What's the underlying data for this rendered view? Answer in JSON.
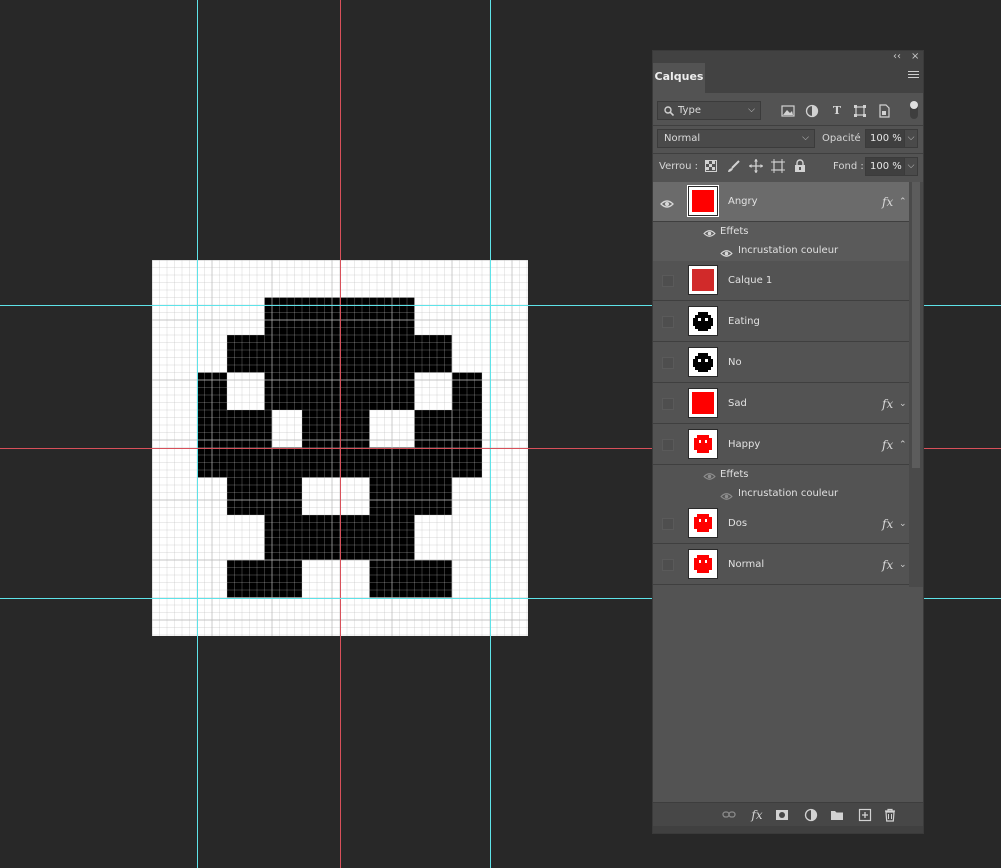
{
  "panel": {
    "collapse_label": "‹‹",
    "close_label": "×",
    "tab_label": "Calques",
    "filter": {
      "kind_label": "Type",
      "kind_icon": "search-icon"
    },
    "blend": {
      "mode": "Normal",
      "opacity_label": "Opacité :",
      "opacity_value": "100 %"
    },
    "lock": {
      "label": "Verrou :",
      "fill_label": "Fond :",
      "fill_value": "100 %"
    }
  },
  "layers": [
    {
      "name": "Angry",
      "visible": true,
      "selected": true,
      "fx": true,
      "expanded": true,
      "thumb": "red-square",
      "effects_label": "Effets",
      "effect_name": "Incrustation couleur"
    },
    {
      "name": "Calque 1",
      "visible": false,
      "selected": false,
      "fx": false,
      "thumb": "dark-red-square"
    },
    {
      "name": "Eating",
      "visible": false,
      "selected": false,
      "fx": false,
      "thumb": "black-creature"
    },
    {
      "name": "No",
      "visible": false,
      "selected": false,
      "fx": false,
      "thumb": "black-creature"
    },
    {
      "name": "Sad",
      "visible": false,
      "selected": false,
      "fx": true,
      "expanded": false,
      "thumb": "red-square"
    },
    {
      "name": "Happy",
      "visible": false,
      "selected": false,
      "fx": true,
      "expanded": true,
      "thumb": "red-creature",
      "effects_label": "Effets",
      "effect_name": "Incrustation couleur"
    },
    {
      "name": "Dos",
      "visible": false,
      "selected": false,
      "fx": true,
      "expanded": false,
      "thumb": "red-creature"
    },
    {
      "name": "Normal",
      "visible": false,
      "selected": false,
      "fx": true,
      "expanded": false,
      "thumb": "red-creature"
    }
  ],
  "fx_label": "fx",
  "colors": {
    "guide_cyan": "#5ee3e9",
    "guide_red": "#d8505a",
    "layer_red": "#ff0000",
    "canvas_bg": "#ffffff",
    "app_bg": "#282828"
  }
}
